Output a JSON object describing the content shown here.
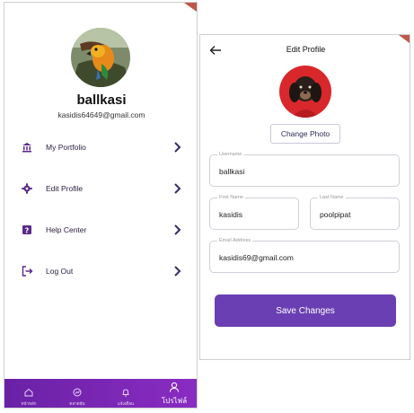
{
  "profile": {
    "username": "ballkasi",
    "email": "kasidis64649@gmail.com"
  },
  "menu": {
    "items": [
      {
        "label": "My Portfolio",
        "icon": "bank-icon"
      },
      {
        "label": "Edit Profile",
        "icon": "gear-icon"
      },
      {
        "label": "Help Center",
        "icon": "help-icon"
      },
      {
        "label": "Log Out",
        "icon": "logout-icon"
      }
    ]
  },
  "bottom_nav": {
    "items": [
      {
        "label": "หน้าหลัก",
        "icon": "home-icon"
      },
      {
        "label": "ตลาดหุ้น",
        "icon": "market-icon"
      },
      {
        "label": "แจ้งเตือน",
        "icon": "bell-icon"
      },
      {
        "label": "โปรไฟล์",
        "icon": "person-icon",
        "active": true
      }
    ]
  },
  "edit_profile": {
    "title": "Edit Profile",
    "change_photo_label": "Change Photo",
    "fields": {
      "username": {
        "label": "Username",
        "value": "ballkasi"
      },
      "first_name": {
        "label": "First Name",
        "value": "kasidis"
      },
      "last_name": {
        "label": "Last Name",
        "value": "poolpipat"
      },
      "email": {
        "label": "Email Address",
        "value": "kasidis69@gmail.com"
      }
    },
    "save_label": "Save Changes"
  },
  "colors": {
    "accent": "#6b3fb4",
    "nav_gradient_start": "#6a21a6",
    "nav_gradient_end": "#8a2cc2",
    "corner_flag": "#c0584a"
  }
}
